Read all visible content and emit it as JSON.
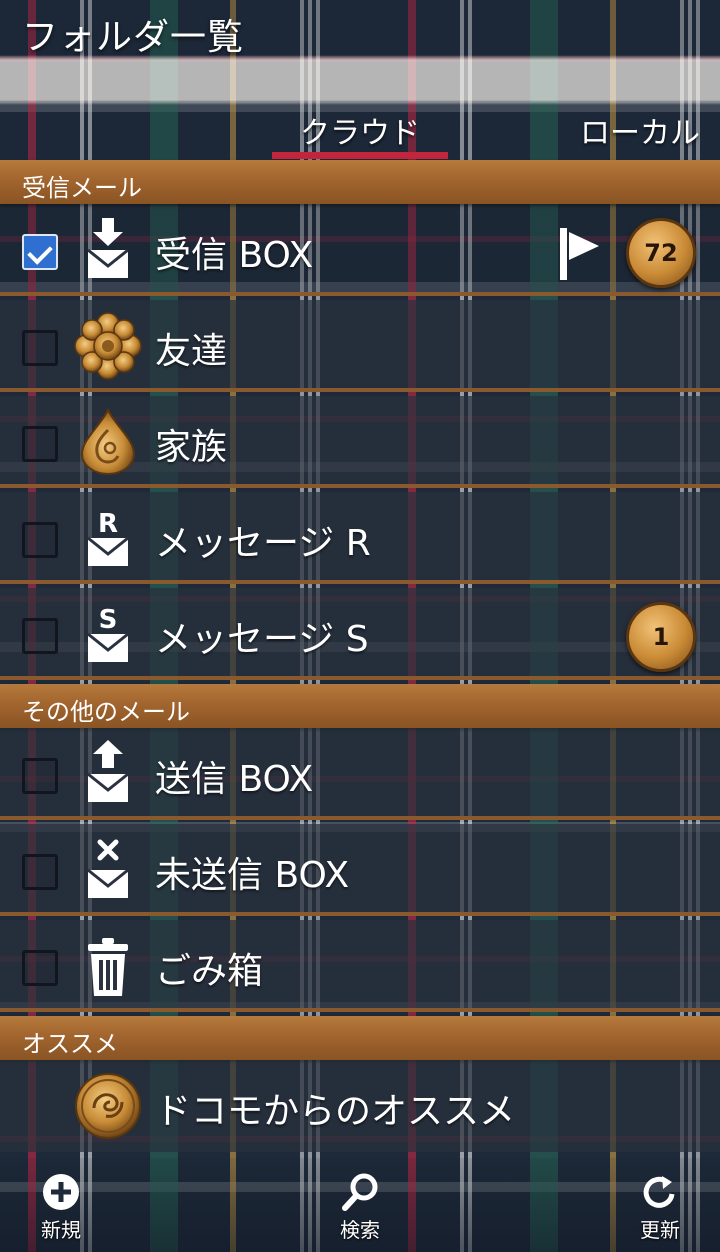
{
  "header": {
    "title": "フォルダ一覧",
    "tabs": [
      {
        "label": "クラウド",
        "active": true
      },
      {
        "label": "ローカル",
        "active": false
      }
    ],
    "accent": "#c3253d"
  },
  "sections": [
    {
      "title": "受信メール",
      "items": [
        {
          "label": "受信 BOX",
          "checked": true,
          "icon": "inbox-download-icon",
          "flag": true,
          "badge": "72"
        },
        {
          "label": "友達",
          "checked": false,
          "icon": "gold-flower-icon"
        },
        {
          "label": "家族",
          "checked": false,
          "icon": "gold-drop-icon"
        },
        {
          "label": "メッセージ R",
          "checked": false,
          "icon": "mail-r-icon",
          "icon_letter": "R"
        },
        {
          "label": "メッセージ S",
          "checked": false,
          "icon": "mail-s-icon",
          "icon_letter": "S",
          "badge": "1"
        }
      ]
    },
    {
      "title": "その他のメール",
      "items": [
        {
          "label": "送信 BOX",
          "checked": false,
          "icon": "outbox-upload-icon"
        },
        {
          "label": "未送信 BOX",
          "checked": false,
          "icon": "unsent-mail-icon"
        },
        {
          "label": "ごみ箱",
          "checked": false,
          "icon": "trash-icon"
        }
      ]
    },
    {
      "title": "オススメ",
      "items": [
        {
          "label": "ドコモからのオススメ",
          "icon": "gold-ornament-icon"
        }
      ]
    }
  ],
  "footer": {
    "new_label": "新規",
    "search_label": "検索",
    "refresh_label": "更新"
  },
  "colors": {
    "section_header": "#a2652e",
    "checkbox_checked": "#2f6fd0",
    "badge_gold": "#c98a35"
  }
}
